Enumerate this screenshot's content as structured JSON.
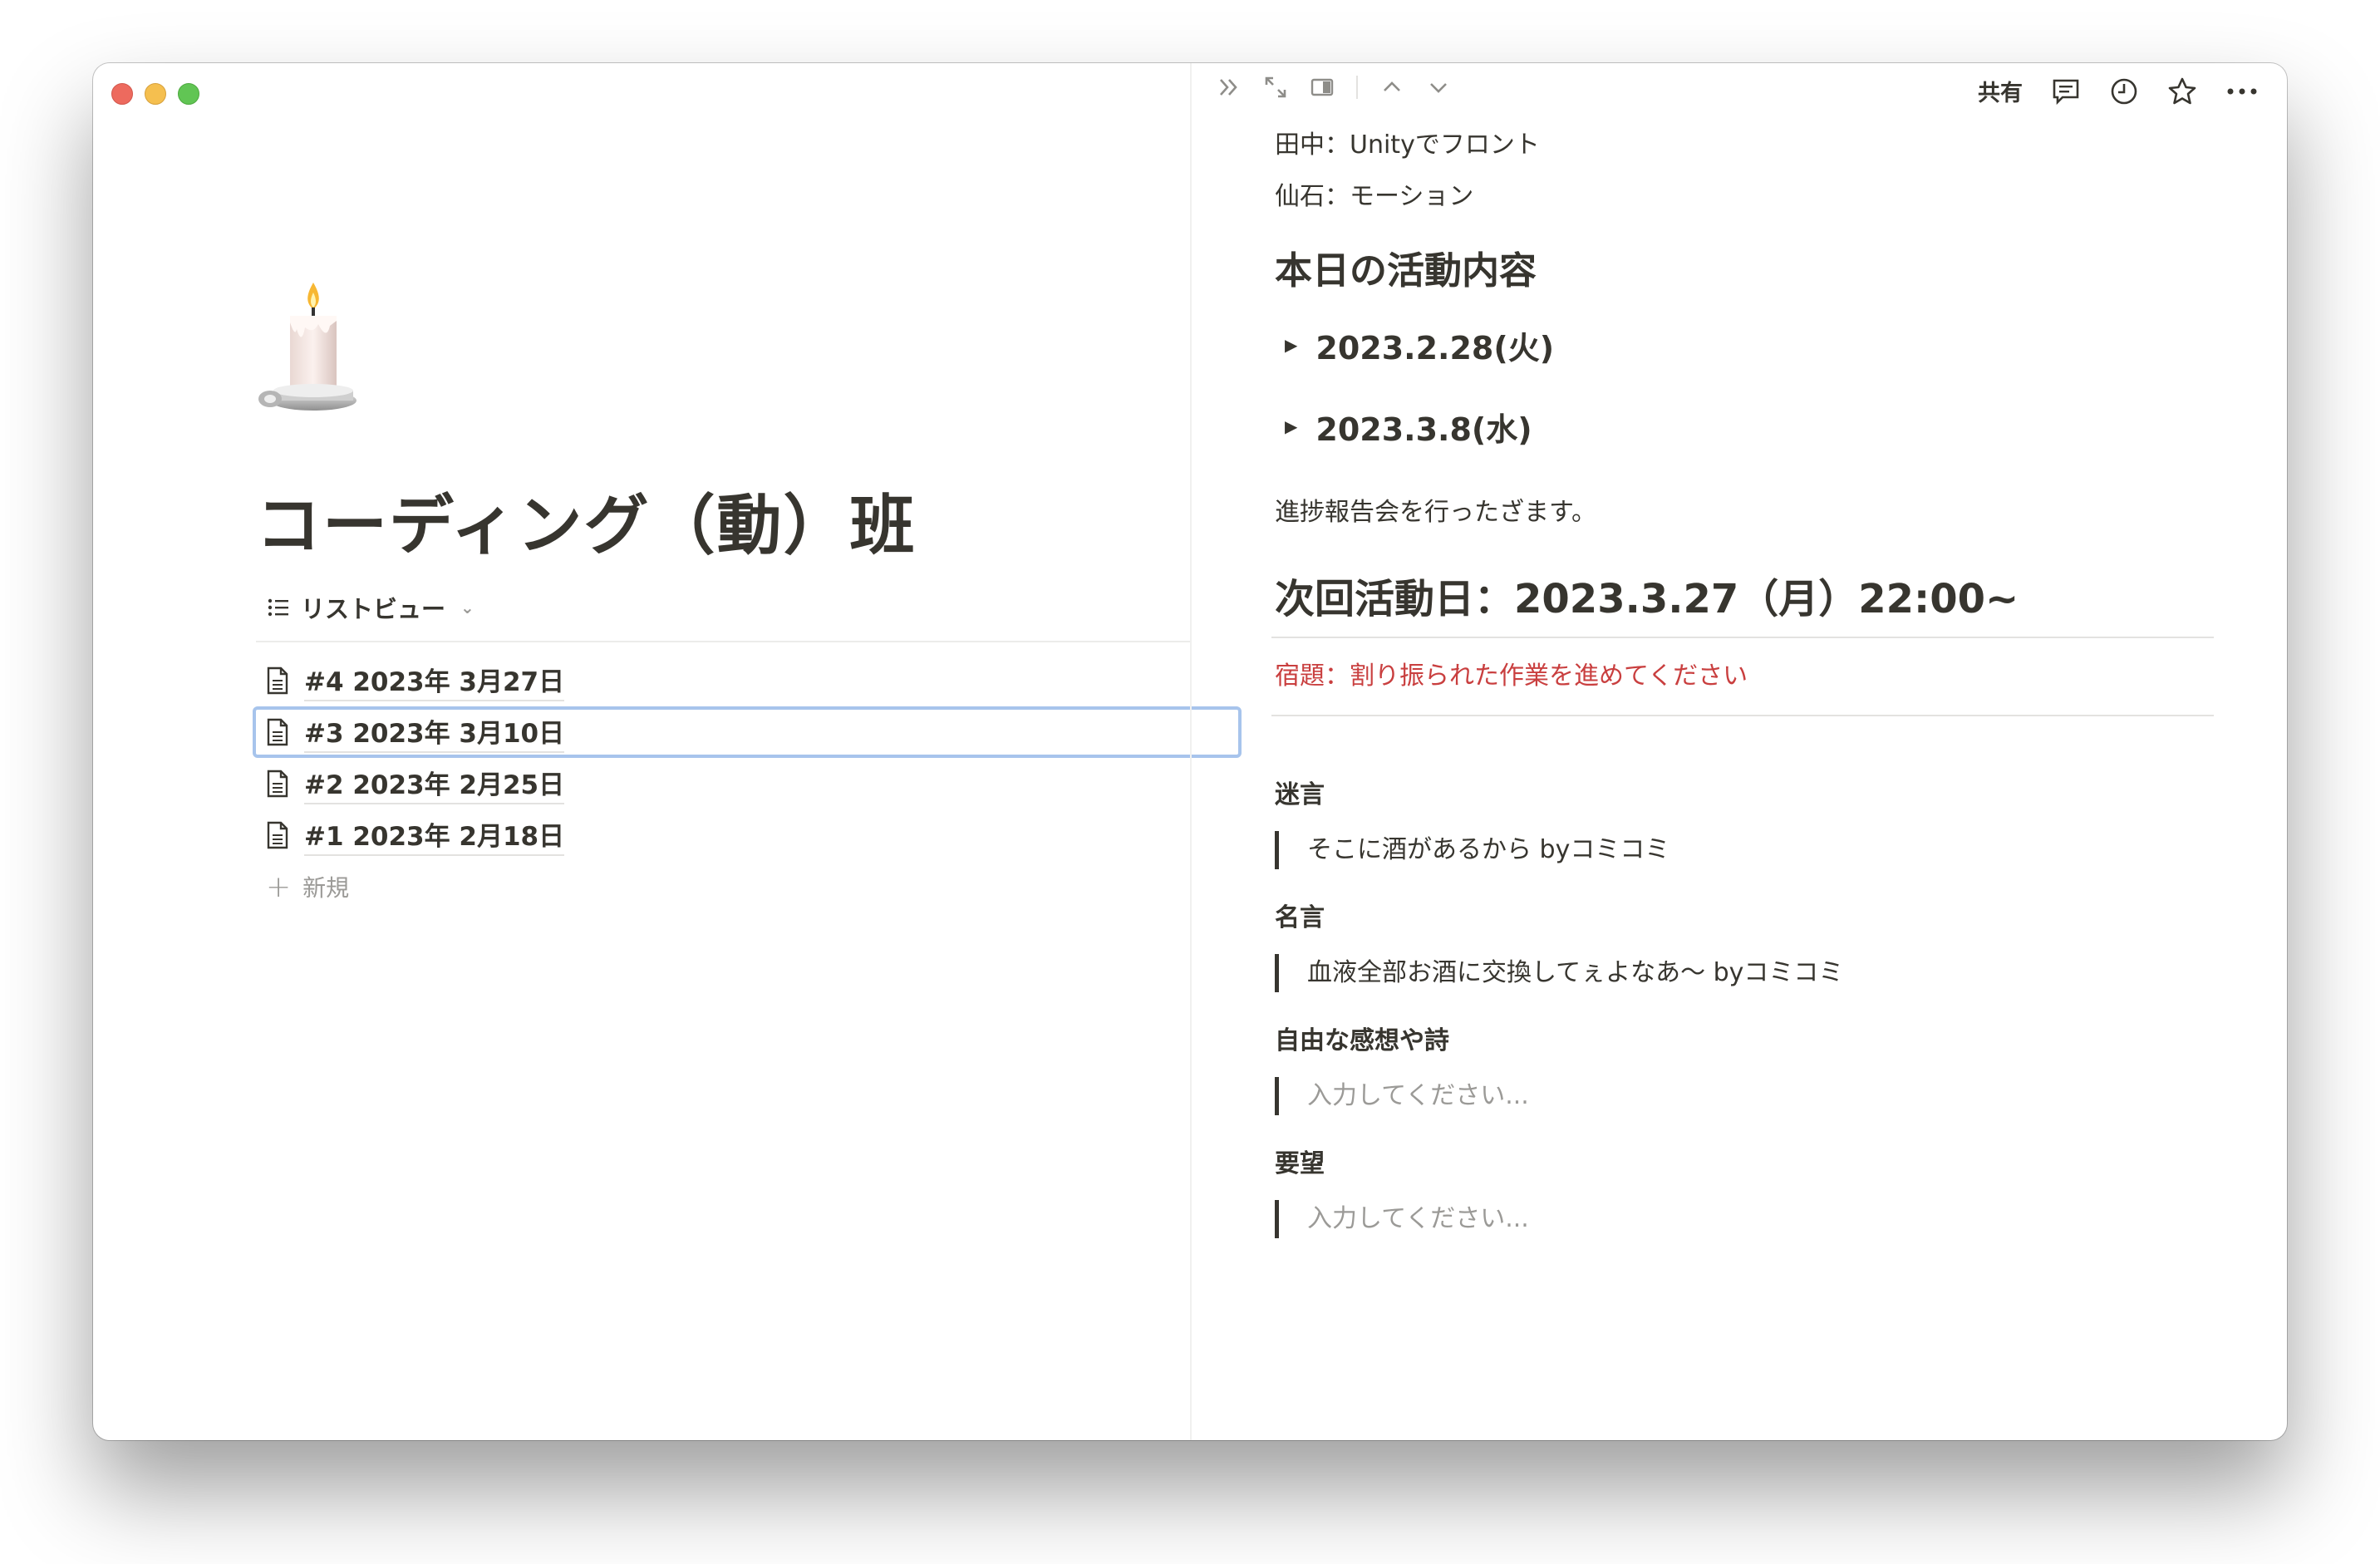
{
  "left_pane": {
    "title": "コーディング（動）班",
    "view_switch": {
      "label": "リストビュー",
      "icon": "list-icon"
    },
    "rows": [
      {
        "label": "#4 2023年 3月27日",
        "icon": "page-icon",
        "selected": false
      },
      {
        "label": "#3 2023年 3月10日",
        "icon": "page-icon",
        "selected": true
      },
      {
        "label": "#2 2023年 2月25日",
        "icon": "page-icon",
        "selected": false
      },
      {
        "label": "#1 2023年 2月18日",
        "icon": "page-icon",
        "selected": false
      }
    ],
    "new_label": "新規"
  },
  "toolbar": {
    "share_label": "共有",
    "icons": [
      "double-chevron-right-icon",
      "expand-icon",
      "side-peek-icon",
      "chevron-up-icon",
      "chevron-down-icon",
      "comment-icon",
      "history-icon",
      "star-icon",
      "more-icon"
    ]
  },
  "right_pane": {
    "lines": [
      "田中：Unityでフロント",
      "仙石：モーション"
    ],
    "activity_heading": "本日の活動内容",
    "toggles": [
      "2023.2.28(火)",
      "2023.3.8(水)"
    ],
    "report": "進捗報告会を行ったざます。",
    "next_heading": "次回活動日：2023.3.27（月）22:00~",
    "homework": "宿題：割り振られた作業を進めてください",
    "sections": [
      {
        "label": "迷言",
        "quote": "そこに酒があるから byコミコミ",
        "is_placeholder": false
      },
      {
        "label": "名言",
        "quote": "血液全部お酒に交換してぇよなあ〜 byコミコミ",
        "is_placeholder": false
      },
      {
        "label": "自由な感想や詩",
        "quote": "入力してください...",
        "is_placeholder": true
      },
      {
        "label": "要望",
        "quote": "入力してください...",
        "is_placeholder": true
      }
    ]
  },
  "colors": {
    "accent_red": "#c93f3f",
    "selection": "#a7c4ec",
    "text": "#37352f",
    "muted": "#9b9a97"
  }
}
